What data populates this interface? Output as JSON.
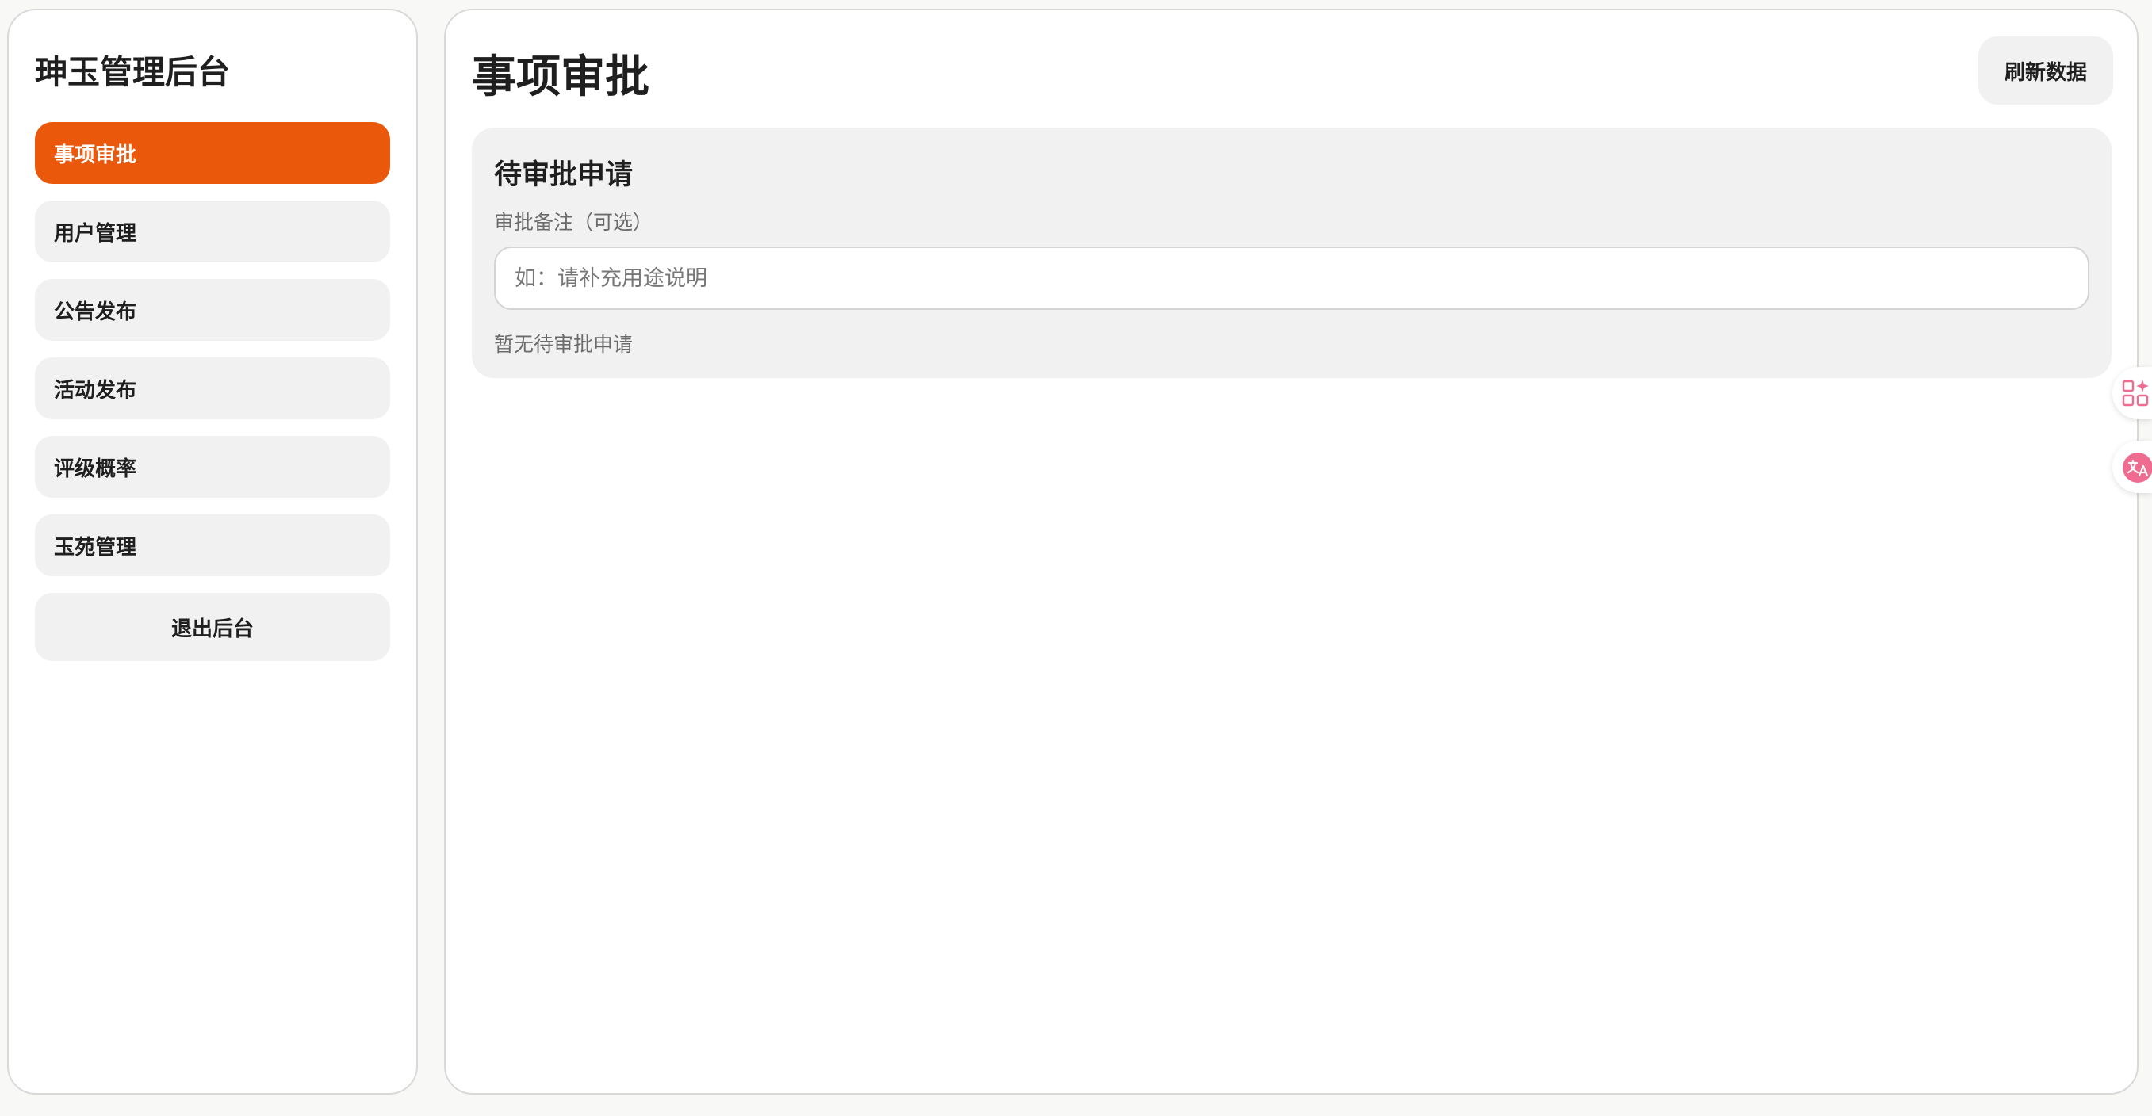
{
  "sidebar": {
    "brand": "珅玉管理后台",
    "items": [
      {
        "label": "事项审批",
        "active": true
      },
      {
        "label": "用户管理",
        "active": false
      },
      {
        "label": "公告发布",
        "active": false
      },
      {
        "label": "活动发布",
        "active": false
      },
      {
        "label": "评级概率",
        "active": false
      },
      {
        "label": "玉苑管理",
        "active": false
      }
    ],
    "logout_label": "退出后台"
  },
  "main": {
    "title": "事项审批",
    "refresh_label": "刷新数据",
    "card": {
      "title": "待审批申请",
      "remark_label": "审批备注（可选）",
      "remark_placeholder": "如：请补充用途说明",
      "remark_value": "",
      "empty_text": "暂无待审批申请"
    }
  },
  "floating_widgets": [
    {
      "icon": "apps-sparkle-icon"
    },
    {
      "icon": "translate-icon"
    }
  ],
  "colors": {
    "accent": "#ea580c",
    "panel_bg": "#f1f1f1",
    "widget_accent": "#ef6b8f"
  }
}
